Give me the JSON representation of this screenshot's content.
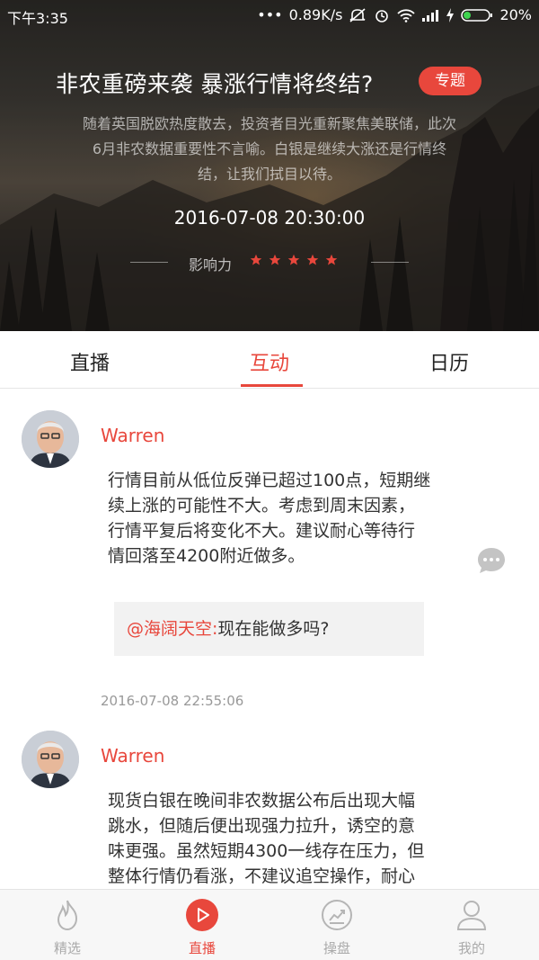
{
  "status_bar": {
    "time": "下午3:35",
    "network_speed": "0.89K/s",
    "battery": "20%"
  },
  "hero": {
    "title": "非农重磅来袭 暴涨行情将终结?",
    "tag": "专题",
    "description": "随着英国脱欧热度散去，投资者目光重新聚焦美联储，此次6月非农数据重要性不言喻。白银是继续大涨还是行情终结，让我们拭目以待。",
    "datetime": "2016-07-08 20:30:00",
    "influence_label": "影响力",
    "influence_stars": 5
  },
  "tabs": [
    {
      "label": "直播",
      "active": false
    },
    {
      "label": "互动",
      "active": true
    },
    {
      "label": "日历",
      "active": false
    }
  ],
  "posts": [
    {
      "author": "Warren",
      "content": "行情目前从低位反弹已超过100点，短期继续上涨的可能性不大。考虑到周末因素，行情平复后将变化不大。建议耐心等待行情回落至4200附近做多。",
      "reply": {
        "mention": "@海阔天空:",
        "text": "现在能做多吗?"
      },
      "timestamp": "2016-07-08 22:55:06"
    },
    {
      "author": "Warren",
      "content": "现货白银在晚间非农数据公布后出现大幅跳水，但随后便出现强力拉升，诱空的意味更强。虽然短期4300一线存在压力，但整体行情仍看涨，不建议追空操作，耐心等待回调逢低做多。"
    }
  ],
  "bottom_nav": [
    {
      "label": "精选",
      "icon": "flame-icon",
      "active": false
    },
    {
      "label": "直播",
      "icon": "play-icon",
      "active": true
    },
    {
      "label": "操盘",
      "icon": "trend-chart-icon",
      "active": false
    },
    {
      "label": "我的",
      "icon": "user-icon",
      "active": false
    }
  ],
  "colors": {
    "accent": "#e8473c",
    "muted": "#aaaaaa"
  }
}
